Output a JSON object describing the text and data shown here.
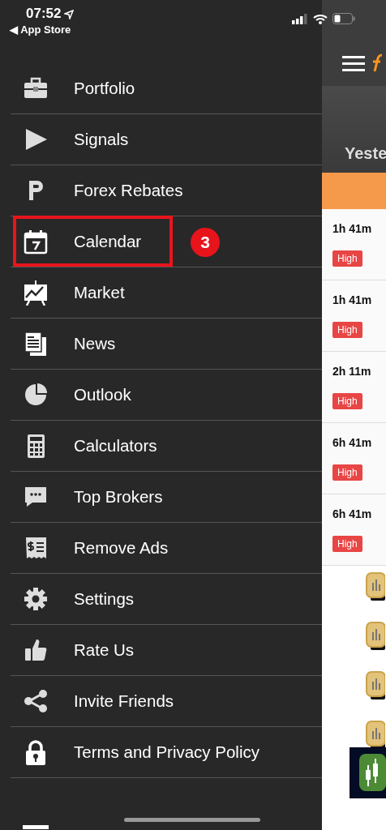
{
  "status_bar": {
    "time": "07:52",
    "back_label": "◀ App Store"
  },
  "menu": [
    {
      "label": "Portfolio",
      "highlighted": false
    },
    {
      "label": "Signals",
      "highlighted": false
    },
    {
      "label": "Forex Rebates",
      "highlighted": false
    },
    {
      "label": "Calendar",
      "highlighted": true,
      "callout": "3"
    },
    {
      "label": "Market",
      "highlighted": false
    },
    {
      "label": "News",
      "highlighted": false
    },
    {
      "label": "Outlook",
      "highlighted": false
    },
    {
      "label": "Calculators",
      "highlighted": false
    },
    {
      "label": "Top Brokers",
      "highlighted": false
    },
    {
      "label": "Remove Ads",
      "highlighted": false
    },
    {
      "label": "Settings",
      "highlighted": false
    },
    {
      "label": "Rate Us",
      "highlighted": false
    },
    {
      "label": "Invite Friends",
      "highlighted": false
    },
    {
      "label": "Terms and Privacy Policy",
      "highlighted": false
    },
    {
      "highlighted": false
    }
  ],
  "background_screen": {
    "heading": "Yeste",
    "events": [
      {
        "time": "1h 41m",
        "impact": "High"
      },
      {
        "time": "1h 41m",
        "impact": "High"
      },
      {
        "time": "2h 11m",
        "impact": "High"
      },
      {
        "time": "6h 41m",
        "impact": "High"
      },
      {
        "time": "6h 41m",
        "impact": "High"
      }
    ]
  }
}
